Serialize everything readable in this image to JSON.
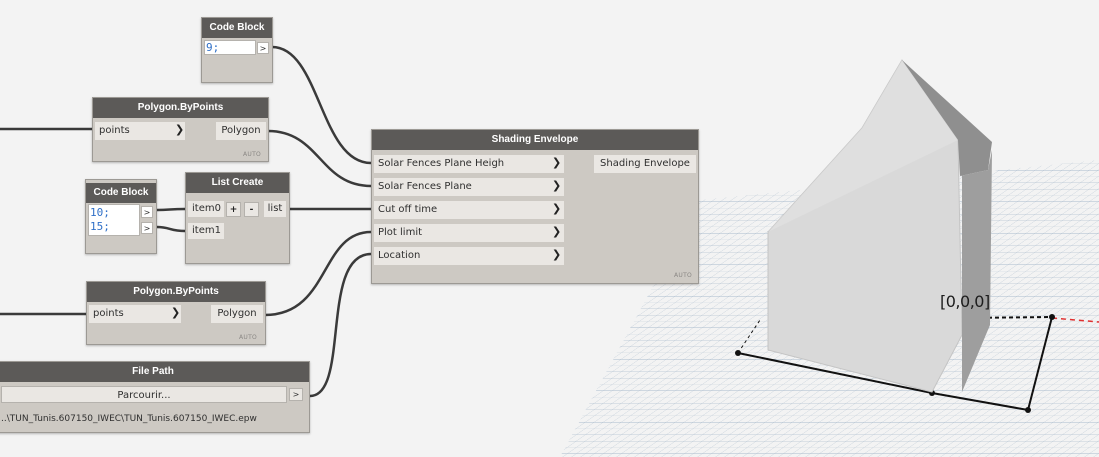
{
  "nodes": {
    "code_block_1": {
      "title": "Code Block",
      "lines": [
        "9;"
      ],
      "output": ">"
    },
    "polygon_by_points_1": {
      "title": "Polygon.ByPoints",
      "input": "points",
      "output": "Polygon",
      "lacing": "AUTO"
    },
    "code_block_2": {
      "title": "Code Block",
      "lines": [
        "10;",
        "15;"
      ],
      "outputs": [
        ">",
        ">"
      ]
    },
    "list_create": {
      "title": "List Create",
      "inputs": [
        "item0",
        "item1"
      ],
      "add": "+",
      "remove": "-",
      "output": "list"
    },
    "shading_envelope": {
      "title": "Shading Envelope",
      "inputs": [
        "Solar Fences Plane Heigh",
        "Solar Fences Plane",
        "Cut off time",
        "Plot limit",
        "Location"
      ],
      "output": "Shading Envelope",
      "lacing": "AUTO"
    },
    "polygon_by_points_2": {
      "title": "Polygon.ByPoints",
      "input": "points",
      "output": "Polygon",
      "lacing": "AUTO"
    },
    "file_path": {
      "title": "File Path",
      "button": "Parcourir...",
      "output": ">",
      "path": "..\\TUN_Tunis.607150_IWEC\\TUN_Tunis.607150_IWEC.epw"
    }
  },
  "icons": {
    "port_chevron": "chevron-right-icon"
  },
  "viewport": {
    "origin_label": "[0,0,0]"
  },
  "colors": {
    "node_header": "#5c5a58",
    "node_body": "#cdc9c3",
    "wire": "#3a3a3a",
    "code_text": "#2f6fc7",
    "grid": "#9fb3c8",
    "x_axis": "#e03030"
  }
}
